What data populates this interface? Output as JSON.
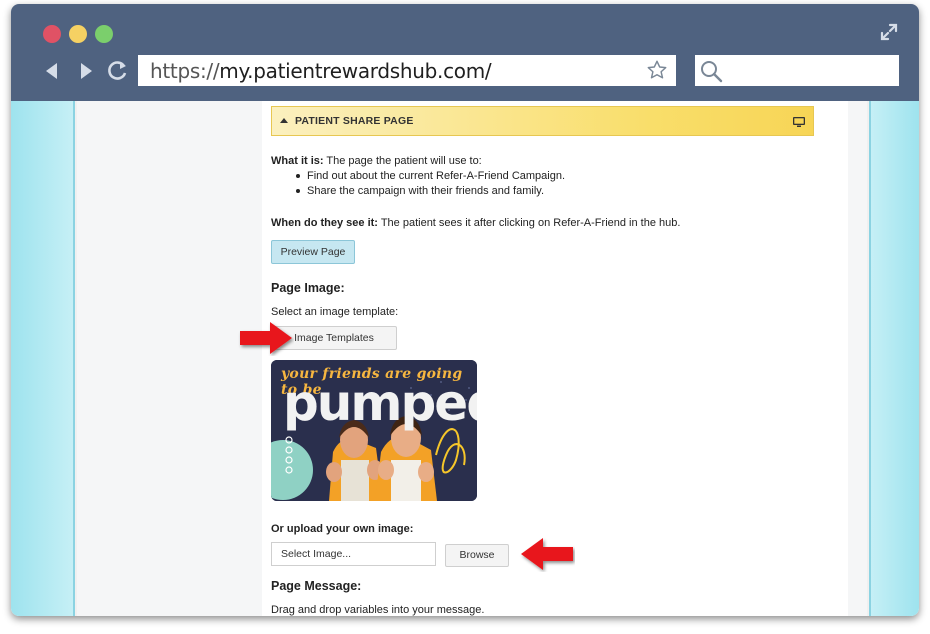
{
  "browser": {
    "url_protocol": "https://",
    "url_host": "my.patientrewardshub.com/",
    "search_placeholder": ""
  },
  "section": {
    "title": "PATIENT SHARE PAGE"
  },
  "what_it_is": {
    "label": "What it is:",
    "text": " The page the patient will use to:",
    "bullets": [
      "Find out about the current Refer-A-Friend Campaign.",
      "Share the campaign with their friends and family."
    ]
  },
  "when_see": {
    "label": "When do they see it:",
    "text": " The patient sees it after clicking on Refer-A-Friend in the hub."
  },
  "preview_button": "Preview Page",
  "page_image": {
    "heading": "Page Image:",
    "instruction": "Select an image template:",
    "templates_button": "Image Templates",
    "template_tagline": "your friends are going to be",
    "template_word": "pumped"
  },
  "upload": {
    "label": "Or upload your own image:",
    "input_value": "Select Image...",
    "browse_button": "Browse"
  },
  "page_message": {
    "heading": "Page Message:",
    "instruction": "Drag and drop variables into your message."
  },
  "colors": {
    "chrome": "#4f6280",
    "header_gold": "#f9de6a",
    "accent_teal": "#9ee3ee",
    "arrow_red": "#e8141b"
  }
}
